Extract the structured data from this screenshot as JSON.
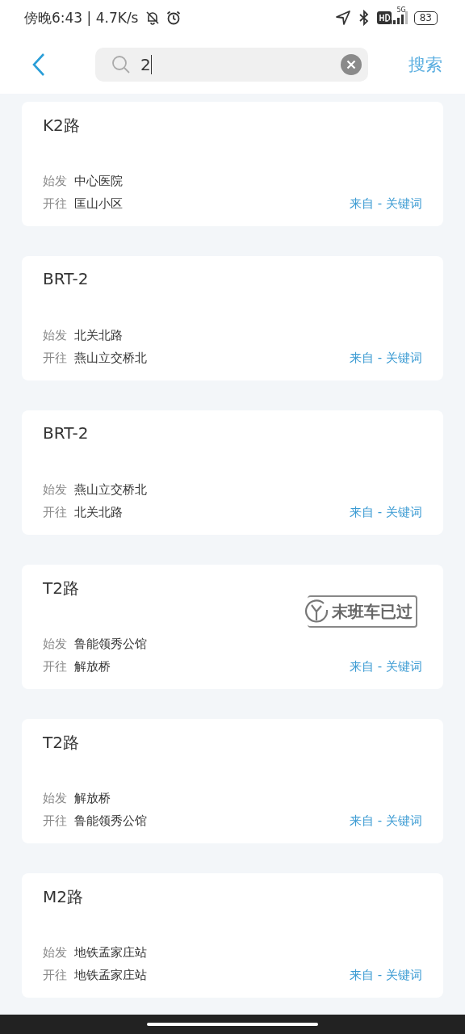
{
  "status_bar": {
    "time": "傍晚6:43 | 4.7K/s",
    "network": "5G",
    "battery": "83"
  },
  "search": {
    "value": "2",
    "submit": "搜索"
  },
  "routes": [
    {
      "name": "K2路",
      "origin_label": "始发",
      "origin": "中心医院",
      "dest_label": "开往",
      "dest": "匡山小区",
      "source": "来自 - 关键词"
    },
    {
      "name": "BRT-2",
      "origin_label": "始发",
      "origin": "北关北路",
      "dest_label": "开往",
      "dest": "燕山立交桥北",
      "source": "来自 - 关键词"
    },
    {
      "name": "BRT-2",
      "origin_label": "始发",
      "origin": "燕山立交桥北",
      "dest_label": "开往",
      "dest": "北关北路",
      "source": "来自 - 关键词"
    },
    {
      "name": "T2路",
      "origin_label": "始发",
      "origin": "鲁能领秀公馆",
      "dest_label": "开往",
      "dest": "解放桥",
      "source": "来自 - 关键词",
      "badge": "末班车已过"
    },
    {
      "name": "T2路",
      "origin_label": "始发",
      "origin": "解放桥",
      "dest_label": "开往",
      "dest": "鲁能领秀公馆",
      "source": "来自 - 关键词"
    },
    {
      "name": "M2路",
      "origin_label": "始发",
      "origin": "地铁孟家庄站",
      "dest_label": "开往",
      "dest": "地铁孟家庄站",
      "source": "来自 - 关键词"
    }
  ]
}
